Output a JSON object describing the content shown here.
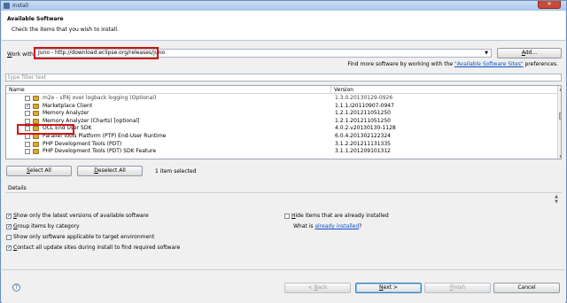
{
  "window": {
    "title": "Install",
    "close_glyph": "✕"
  },
  "header": {
    "title": "Available Software",
    "subtitle": "Check the items that you wish to install."
  },
  "work_with": {
    "label_first": "W",
    "label_rest": "ork with:",
    "value": "Juno - http://download.eclipse.org/releases/juno",
    "add_first": "A",
    "add_rest": "dd..."
  },
  "more_software": {
    "prefix": "Find more software by working with the ",
    "link": "\"Available Software Sites\"",
    "suffix": " preferences."
  },
  "filter": {
    "placeholder": "type filter text"
  },
  "table": {
    "headers": [
      "Name",
      "Version"
    ],
    "rows": [
      {
        "name": "m2e - slf4j over logback logging (Optional)",
        "version": "1.3.0.20130129-0926",
        "checked": false
      },
      {
        "name": "Marketplace Client",
        "version": "1.1.1.I20110907-0947",
        "checked": true
      },
      {
        "name": "Memory Analyzer",
        "version": "1.2.1.201211051250",
        "checked": false
      },
      {
        "name": "Memory Analyzer (Charts) [optional]",
        "version": "1.2.1.201211051250",
        "checked": false
      },
      {
        "name": "OCL End User SDK",
        "version": "4.0.2.v20130130-1128",
        "checked": false
      },
      {
        "name": "Parallel Tools Platform (PTP) End-User Runtime",
        "version": "6.0.4.201302122324",
        "checked": false
      },
      {
        "name": "PHP Development Tools (PDT)",
        "version": "3.1.2.201211131335",
        "checked": false
      },
      {
        "name": "PHP Development Tools (PDT) SDK Feature",
        "version": "3.1.1.201209101312",
        "checked": false
      }
    ]
  },
  "selection": {
    "select_all_first": "S",
    "select_all_rest": "elect All",
    "deselect_all_first": "D",
    "deselect_all_rest": "eselect All",
    "count": "1 item selected"
  },
  "details": {
    "label": "Details"
  },
  "options": {
    "latest_first": "S",
    "latest_rest": "how only the latest versions of available software",
    "group_first": "G",
    "group_rest": "roup items by category",
    "applicable": "Show only software applicable to target environment",
    "contact_first": "C",
    "contact_rest": "ontact all update sites during install to find required software",
    "hide_first": "H",
    "hide_rest": "ide items that are already installed",
    "what_prefix": "What is ",
    "what_link": "already installed",
    "what_suffix": "?"
  },
  "footer": {
    "help_glyph": "?",
    "back_prefix": "< ",
    "back_first": "B",
    "back_rest": "ack",
    "next_first": "N",
    "next_rest": "ext >",
    "finish_first": "F",
    "finish_rest": "inish",
    "cancel": "Cancel"
  },
  "colors": {
    "highlight": "#d21414",
    "link": "#0b4fc7"
  }
}
